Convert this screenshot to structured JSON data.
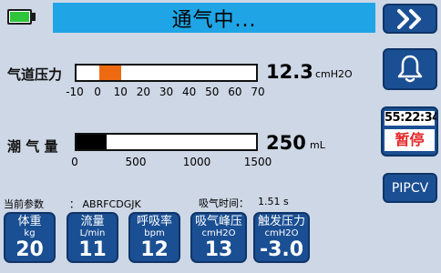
{
  "header": {
    "status": "通气中...",
    "battery_level": 1.0,
    "battery_color": "#2ec53a",
    "title_bg": "#1fa5e6"
  },
  "right_panel": {
    "next_icon": "double-chevron-right-icon",
    "alarm_icon": "bell-icon",
    "timer": "55:22:34",
    "pause_label": "暂停",
    "mode_label": "PIPCV"
  },
  "airway_pressure": {
    "label": "气道压力",
    "value": "12.3",
    "unit": "cmH2O",
    "scale_min": -10,
    "scale_max": 70,
    "ticks": [
      "-10",
      "0",
      "10",
      "20",
      "30",
      "40",
      "50",
      "60",
      "70"
    ],
    "bar_from": 0,
    "bar_to": 10,
    "bar_color": "#ee6a10"
  },
  "tidal_volume": {
    "label": "潮 气 量",
    "value": "250",
    "unit": "mL",
    "scale_min": 0,
    "scale_max": 1500,
    "ticks": [
      "0",
      "500",
      "1000",
      "1500"
    ],
    "bar_fill_value": 250,
    "bar_color": "#000000"
  },
  "params": {
    "current_label": "当前参数",
    "current_value": "： ABRFCDGJK",
    "insp_time_label": "吸气时间：",
    "insp_time_value": "1.51 s",
    "cards": [
      {
        "name": "体重",
        "unit": "kg",
        "value": "20"
      },
      {
        "name": "流量",
        "unit": "L/min",
        "value": "11"
      },
      {
        "name": "呼吸率",
        "unit": "bpm",
        "value": "12"
      },
      {
        "name": "吸气峰压",
        "unit": "cmH2O",
        "value": "13"
      },
      {
        "name": "触发压力",
        "unit": "cmH2O",
        "value": "-3.0"
      }
    ]
  }
}
